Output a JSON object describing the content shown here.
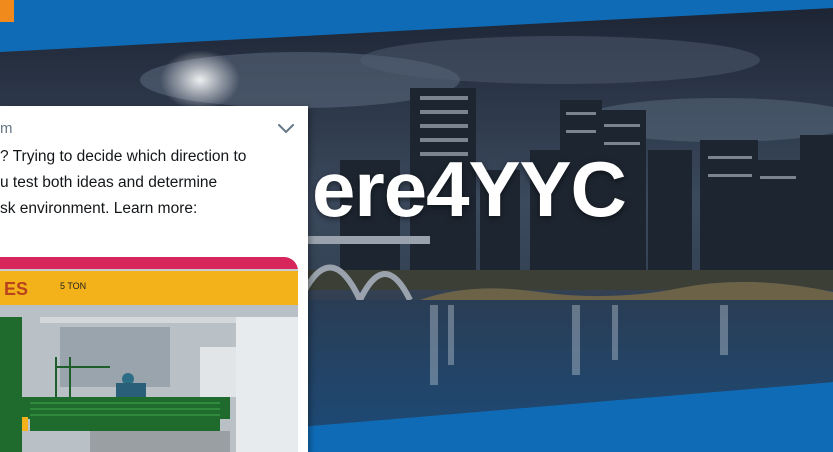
{
  "banner": {
    "tagline": "ere4YYC",
    "colors": {
      "brand_blue": "#0f6bb6",
      "accent_orange": "#f08a1c"
    }
  },
  "tweet": {
    "handle_fragment": "m",
    "text_lines": [
      "? Trying to decide which direction to",
      "u test both ideas and determine",
      "sk environment. Learn more:"
    ],
    "menu_icon": "chevron-down-icon",
    "media_sign": "5 TON",
    "media_wall_text": "ES"
  }
}
